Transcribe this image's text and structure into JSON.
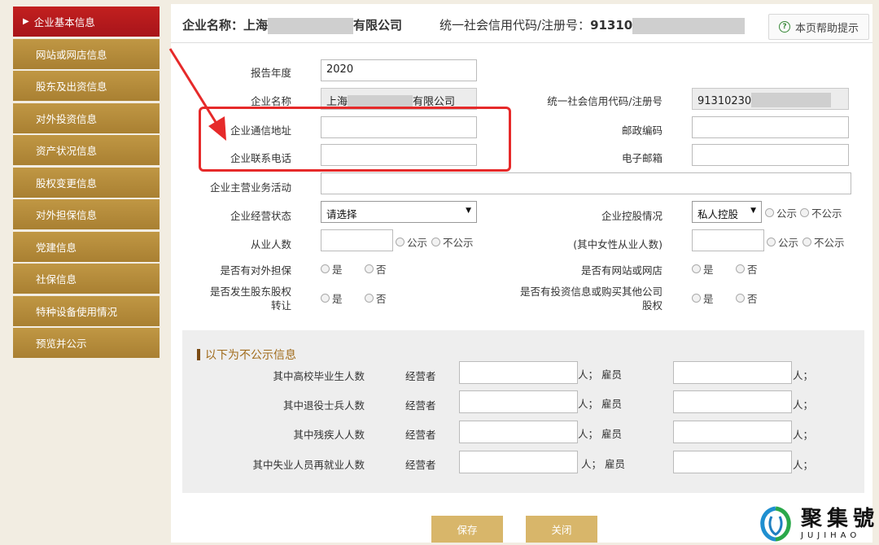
{
  "sidebar": {
    "items": [
      {
        "label": "企业基本信息",
        "active": true
      },
      {
        "label": "网站或网店信息"
      },
      {
        "label": "股东及出资信息"
      },
      {
        "label": "对外投资信息"
      },
      {
        "label": "资产状况信息"
      },
      {
        "label": "股权变更信息"
      },
      {
        "label": "对外担保信息"
      },
      {
        "label": "党建信息"
      },
      {
        "label": "社保信息"
      },
      {
        "label": "特种设备使用情况"
      },
      {
        "label": "预览并公示"
      }
    ]
  },
  "header": {
    "company_prefix": "企业名称：上海",
    "company_suffix": "有限公司",
    "credit_label": "统一社会信用代码/注册号：",
    "credit_value": "91310",
    "help_label": "本页帮助提示"
  },
  "form": {
    "report_year_label": "报告年度",
    "report_year_value": "2020",
    "company_name_label": "企业名称",
    "company_name_prefix": "上海",
    "company_name_suffix": "有限公司",
    "credit_code_label": "统一社会信用代码/注册号",
    "credit_code_value": "91310230",
    "address_label": "企业通信地址",
    "postcode_label": "邮政编码",
    "phone_label": "企业联系电话",
    "email_label": "电子邮箱",
    "business_label": "企业主营业务活动",
    "status_label": "企业经营状态",
    "status_value": "请选择",
    "holding_label": "企业控股情况",
    "holding_value": "私人控股",
    "public_label": "公示",
    "nonpublic_label": "不公示",
    "employees_label": "从业人数",
    "female_label": "(其中女性从业人数)",
    "guarantee_label": "是否有对外担保",
    "website_label": "是否有网站或网店",
    "equity_transfer_label_1": "是否发生股东股权",
    "equity_transfer_label_2": "转让",
    "invest_label_1": "是否有投资信息或购买其他公司",
    "invest_label_2": "股权",
    "yes": "是",
    "no": "否"
  },
  "nonpublic": {
    "title": "以下为不公示信息",
    "operator_label": "经营者",
    "unit_employee": "人；  雇员",
    "unit_end": "人；",
    "rows": [
      {
        "label": "其中高校毕业生人数"
      },
      {
        "label": "其中退役士兵人数"
      },
      {
        "label": "其中残疾人人数"
      },
      {
        "label": "其中失业人员再就业人数"
      }
    ]
  },
  "buttons": {
    "save": "保存",
    "close": "关闭"
  },
  "watermark": {
    "cn": "聚集號",
    "en": "JUJIHAO"
  },
  "colors": {
    "active": "#b5191b",
    "sidebar": "#b98f3d",
    "highlight": "#e62a2a"
  }
}
